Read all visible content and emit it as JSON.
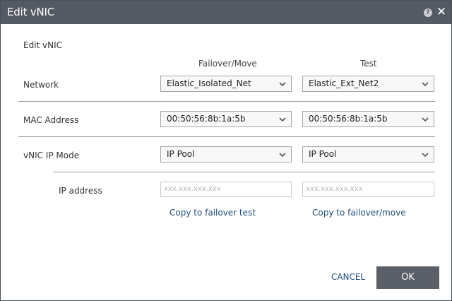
{
  "dialog": {
    "title": "Edit vNIC",
    "section_label": "Edit vNIC",
    "columns": {
      "failover": "Failover/Move",
      "test": "Test"
    },
    "rows": {
      "network": {
        "label": "Network",
        "failover_value": "Elastic_Isolated_Net",
        "test_value": "Elastic_Ext_Net2"
      },
      "mac": {
        "label": "MAC Address",
        "failover_value": "00:50:56:8b:1a:5b",
        "test_value": "00:50:56:8b:1a:5b"
      },
      "ip_mode": {
        "label": "vNIC IP Mode",
        "failover_value": "IP Pool",
        "test_value": "IP Pool"
      },
      "ip_address": {
        "label": "IP address",
        "failover_placeholder": "xxx.xxx.xxx.xxx",
        "test_placeholder": "xxx.xxx.xxx.xxx"
      }
    },
    "links": {
      "copy_to_test": "Copy to failover test",
      "copy_to_move": "Copy to failover/move"
    },
    "buttons": {
      "cancel": "CANCEL",
      "ok": "OK"
    },
    "icons": {
      "help": "help-icon",
      "close": "close-icon",
      "dropdown": "chevron-down-icon"
    },
    "colors": {
      "titlebar": "#545a64",
      "link": "#1f4e79",
      "ok_button": "#5b6068"
    }
  }
}
